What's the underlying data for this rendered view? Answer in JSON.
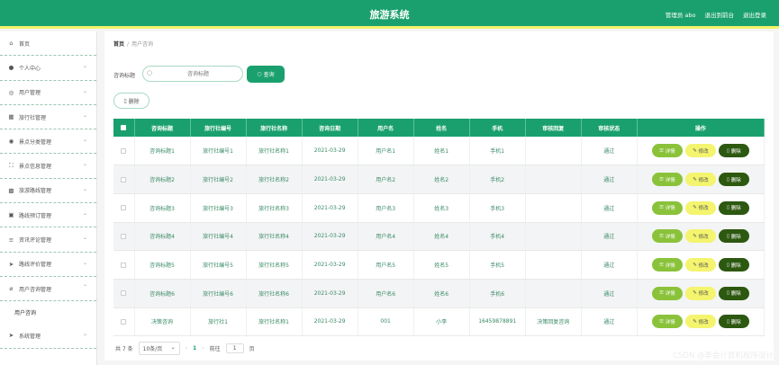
{
  "header": {
    "title": "旅游系统",
    "links": [
      "管理员 abo",
      "退出到前台",
      "退出登录"
    ]
  },
  "sidebar": {
    "items": [
      {
        "label": "首页",
        "icon": "home-icon",
        "glyph": "⌂",
        "expandable": false
      },
      {
        "label": "个人中心",
        "icon": "user-icon",
        "glyph": "●",
        "expandable": true
      },
      {
        "label": "用户管理",
        "icon": "globe-icon",
        "glyph": "◎",
        "expandable": true
      },
      {
        "label": "旅行社管理",
        "icon": "grid-icon",
        "glyph": "▦",
        "expandable": true
      },
      {
        "label": "景点分类管理",
        "icon": "pin-icon",
        "glyph": "◉",
        "expandable": true
      },
      {
        "label": "景点信息管理",
        "icon": "expand-icon",
        "glyph": "⛶",
        "expandable": true
      },
      {
        "label": "旅游路线管理",
        "icon": "apps-icon",
        "glyph": "▩",
        "expandable": true
      },
      {
        "label": "路线预订管理",
        "icon": "book-icon",
        "glyph": "▣",
        "expandable": true
      },
      {
        "label": "资讯评论管理",
        "icon": "list-icon",
        "glyph": "≡",
        "expandable": true
      },
      {
        "label": "路线评价管理",
        "icon": "send-icon",
        "glyph": "➤",
        "expandable": true
      },
      {
        "label": "用户咨询管理",
        "icon": "attach-icon",
        "glyph": "⌀",
        "expandable": true,
        "expanded": true
      }
    ],
    "sub_items": [
      "用户咨询"
    ],
    "last_item": {
      "label": "系统管理",
      "icon": "send-icon",
      "glyph": "➤"
    }
  },
  "breadcrumb": {
    "home": "首页",
    "separator": "/",
    "current": "用户咨询"
  },
  "search": {
    "label": "咨询标题",
    "placeholder": "咨询标题",
    "button": "查询"
  },
  "actions": {
    "delete_label": "删除"
  },
  "table": {
    "headers": [
      "咨询标题",
      "旅行社编号",
      "旅行社名称",
      "咨询日期",
      "用户名",
      "姓名",
      "手机",
      "审核回复",
      "审核状态",
      "操作"
    ],
    "rows": [
      [
        "咨询标题1",
        "旅行社编号1",
        "旅行社名称1",
        "2021-03-29",
        "用户名1",
        "姓名1",
        "手机1",
        "",
        "通过"
      ],
      [
        "咨询标题2",
        "旅行社编号2",
        "旅行社名称2",
        "2021-03-29",
        "用户名2",
        "姓名2",
        "手机2",
        "",
        "通过"
      ],
      [
        "咨询标题3",
        "旅行社编号3",
        "旅行社名称3",
        "2021-03-29",
        "用户名3",
        "姓名3",
        "手机3",
        "",
        "通过"
      ],
      [
        "咨询标题4",
        "旅行社编号4",
        "旅行社名称4",
        "2021-03-29",
        "用户名4",
        "姓名4",
        "手机4",
        "",
        "通过"
      ],
      [
        "咨询标题5",
        "旅行社编号5",
        "旅行社名称5",
        "2021-03-29",
        "用户名5",
        "姓名5",
        "手机5",
        "",
        "通过"
      ],
      [
        "咨询标题6",
        "旅行社编号6",
        "旅行社名称6",
        "2021-03-29",
        "用户名6",
        "姓名6",
        "手机6",
        "",
        "通过"
      ],
      [
        "决策咨询",
        "旅行社1",
        "旅行社名称1",
        "2021-03-29",
        "001",
        "小李",
        "16459878891",
        "决策回复咨询",
        "通过"
      ]
    ],
    "op_labels": {
      "detail": "详情",
      "edit": "修改",
      "delete": "删除"
    }
  },
  "pager": {
    "total": "共 7 条",
    "page_size": "10条/页",
    "current_page": "1",
    "goto_label": "前往",
    "goto_value": "1",
    "page_suffix": "页"
  },
  "watermark": "CSDN @李会计算机程序设计",
  "colors": {
    "primary": "#1aa06e",
    "accent_yellow": "#f3f36a",
    "detail_btn": "#8ac23a",
    "edit_btn": "#f4f46e",
    "delete_btn": "#2c5810"
  }
}
